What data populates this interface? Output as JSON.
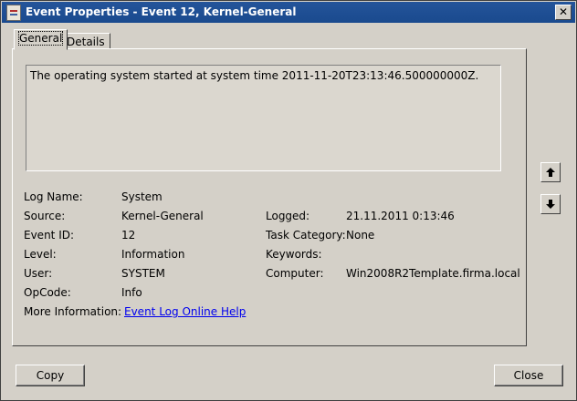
{
  "window": {
    "title": "Event Properties - Event 12, Kernel-General",
    "close_label": "✕"
  },
  "tabs": [
    {
      "label": "General"
    },
    {
      "label": "Details"
    }
  ],
  "message": "The operating system started at system time 2011-11-20T23:13:46.500000000Z.",
  "fields": {
    "log_name": {
      "label": "Log Name:",
      "value": "System"
    },
    "source": {
      "label": "Source:",
      "value": "Kernel-General"
    },
    "event_id": {
      "label": "Event ID:",
      "value": "12"
    },
    "level": {
      "label": "Level:",
      "value": "Information"
    },
    "user": {
      "label": "User:",
      "value": "SYSTEM"
    },
    "opcode": {
      "label": "OpCode:",
      "value": "Info"
    },
    "more_info": {
      "label": "More Information:",
      "value": "Event Log Online Help"
    },
    "logged": {
      "label": "Logged:",
      "value": "21.11.2011 0:13:46"
    },
    "task_category": {
      "label": "Task Category:",
      "value": "None"
    },
    "keywords": {
      "label": "Keywords:",
      "value": ""
    },
    "computer": {
      "label": "Computer:",
      "value": "Win2008R2Template.firma.local"
    }
  },
  "buttons": {
    "copy": "Copy",
    "close": "Close"
  },
  "nav_icons": {
    "up": "arrow-up-icon",
    "down": "arrow-down-icon"
  }
}
